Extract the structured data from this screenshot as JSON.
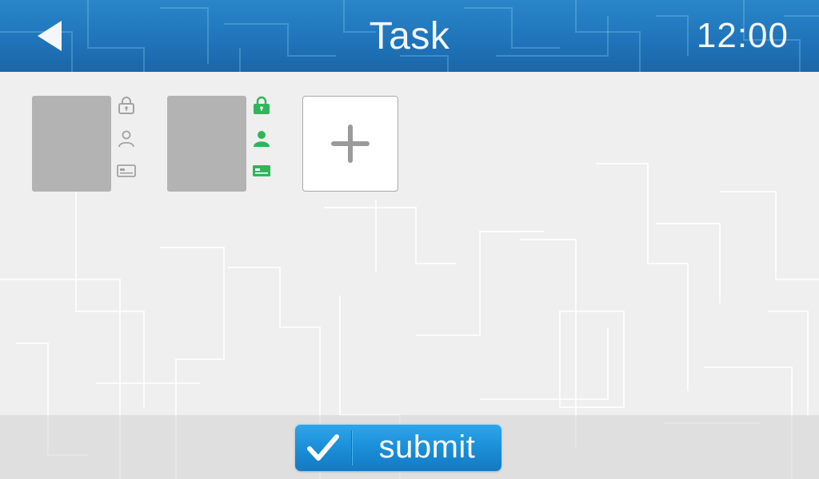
{
  "header": {
    "title": "Task",
    "clock": "12:00"
  },
  "icons": {
    "back": "back-arrow-icon",
    "lock": "lock-icon",
    "person": "person-icon",
    "card": "id-card-icon",
    "add": "plus-icon",
    "check": "checkmark-icon"
  },
  "users": [
    {
      "status": "inactive",
      "icon_color": "#a3a3a3"
    },
    {
      "status": "active",
      "icon_color": "#2eb65a"
    }
  ],
  "footer": {
    "submit_label": "submit"
  },
  "colors": {
    "header_blue": "#1f73b9",
    "accent_green": "#2eb65a",
    "button_blue": "#1b8fd8"
  }
}
